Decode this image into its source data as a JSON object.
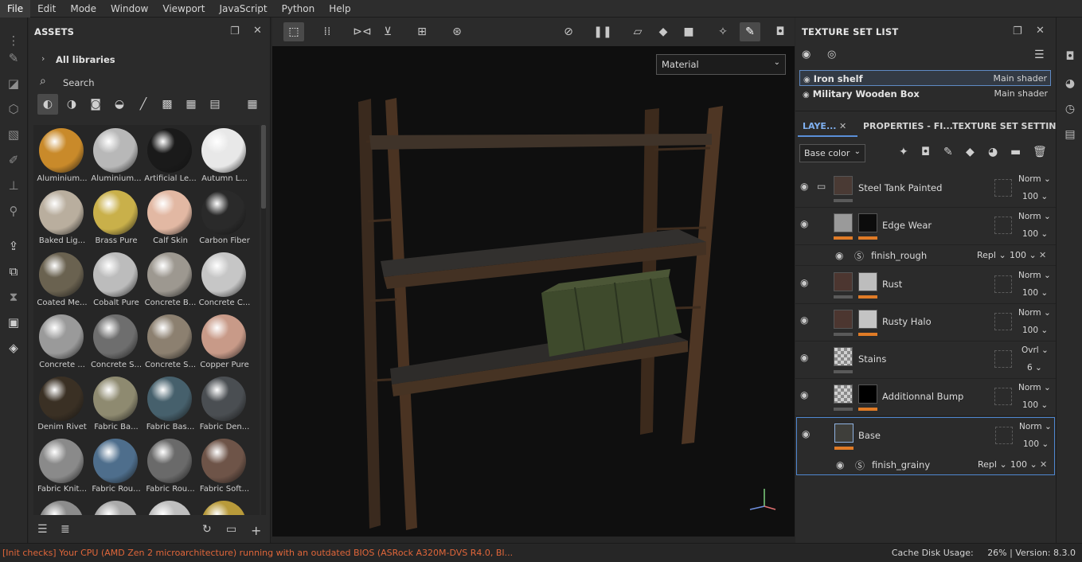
{
  "menu": [
    "File",
    "Edit",
    "Mode",
    "Window",
    "Viewport",
    "JavaScript",
    "Python",
    "Help"
  ],
  "assets": {
    "title": "ASSETS",
    "libraries": "All libraries",
    "search_placeholder": "Search",
    "items": [
      {
        "label": "Aluminium...",
        "color": "#c98a2a"
      },
      {
        "label": "Aluminium...",
        "color": "#b8b8b8"
      },
      {
        "label": "Artificial Le...",
        "color": "#1a1a1a"
      },
      {
        "label": "Autumn L...",
        "color": "#e8e8e8"
      },
      {
        "label": "Baked Lig...",
        "color": "#b9ae9e"
      },
      {
        "label": "Brass Pure",
        "color": "#c9b04a"
      },
      {
        "label": "Calf Skin",
        "color": "#e2b8a3"
      },
      {
        "label": "Carbon Fiber",
        "color": "#2a2a2a"
      },
      {
        "label": "Coated Me...",
        "color": "#6a6250"
      },
      {
        "label": "Cobalt Pure",
        "color": "#bcbcbc"
      },
      {
        "label": "Concrete B...",
        "color": "#9d9890"
      },
      {
        "label": "Concrete C...",
        "color": "#c6c6c6"
      },
      {
        "label": "Concrete ...",
        "color": "#9a9a9a"
      },
      {
        "label": "Concrete S...",
        "color": "#6e6e6e"
      },
      {
        "label": "Concrete S...",
        "color": "#8c8070"
      },
      {
        "label": "Copper Pure",
        "color": "#c89a88"
      },
      {
        "label": "Denim Rivet",
        "color": "#3a3024"
      },
      {
        "label": "Fabric Ba...",
        "color": "#8e8a70"
      },
      {
        "label": "Fabric Bas...",
        "color": "#46606c"
      },
      {
        "label": "Fabric Den...",
        "color": "#4a4e52"
      },
      {
        "label": "Fabric Knit...",
        "color": "#8a8a8a"
      },
      {
        "label": "Fabric Rou...",
        "color": "#4e6e8c"
      },
      {
        "label": "Fabric Rou...",
        "color": "#6a6a6a"
      },
      {
        "label": "Fabric Soft...",
        "color": "#6e5448"
      },
      {
        "label": "",
        "color": "#8c8c8c"
      },
      {
        "label": "",
        "color": "#aaaaaa"
      },
      {
        "label": "",
        "color": "#bfbfbf"
      },
      {
        "label": "",
        "color": "#b89a3a"
      }
    ]
  },
  "viewport": {
    "material_select": "Material"
  },
  "texture_set_list": {
    "title": "TEXTURE SET LIST",
    "items": [
      {
        "name": "Iron shelf",
        "shader": "Main shader"
      },
      {
        "name": "Military Wooden Box",
        "shader": "Main shader"
      }
    ]
  },
  "layers_panel": {
    "tabs": [
      "LAYE...",
      "PROPERTIES - FI...",
      "TEXTURE SET SETTIN..."
    ],
    "channel": "Base color",
    "layers": [
      {
        "name": "Steel Tank Painted",
        "blend": "Norm",
        "opacity": "100"
      },
      {
        "name": "Edge Wear",
        "blend": "Norm",
        "opacity": "100"
      },
      {
        "name": "Rust",
        "blend": "Norm",
        "opacity": "100"
      },
      {
        "name": "Rusty Halo",
        "blend": "Norm",
        "opacity": "100"
      },
      {
        "name": "Stains",
        "blend": "Ovrl",
        "opacity": "6"
      },
      {
        "name": "Additionnal Bump",
        "blend": "Norm",
        "opacity": "100"
      },
      {
        "name": "Base",
        "blend": "Norm",
        "opacity": "100"
      }
    ],
    "effects": [
      {
        "name": "finish_rough",
        "mode": "Repl",
        "opacity": "100"
      },
      {
        "name": "finish_grainy",
        "mode": "Repl",
        "opacity": "100"
      }
    ]
  },
  "status": {
    "message": "[Init checks] Your CPU (AMD Zen 2 microarchitecture) running with an outdated BIOS (ASRock A320M-DVS R4.0, BI...",
    "cache": "Cache Disk Usage:",
    "cache_value": "26%",
    "version": "Version: 8.3.0"
  }
}
